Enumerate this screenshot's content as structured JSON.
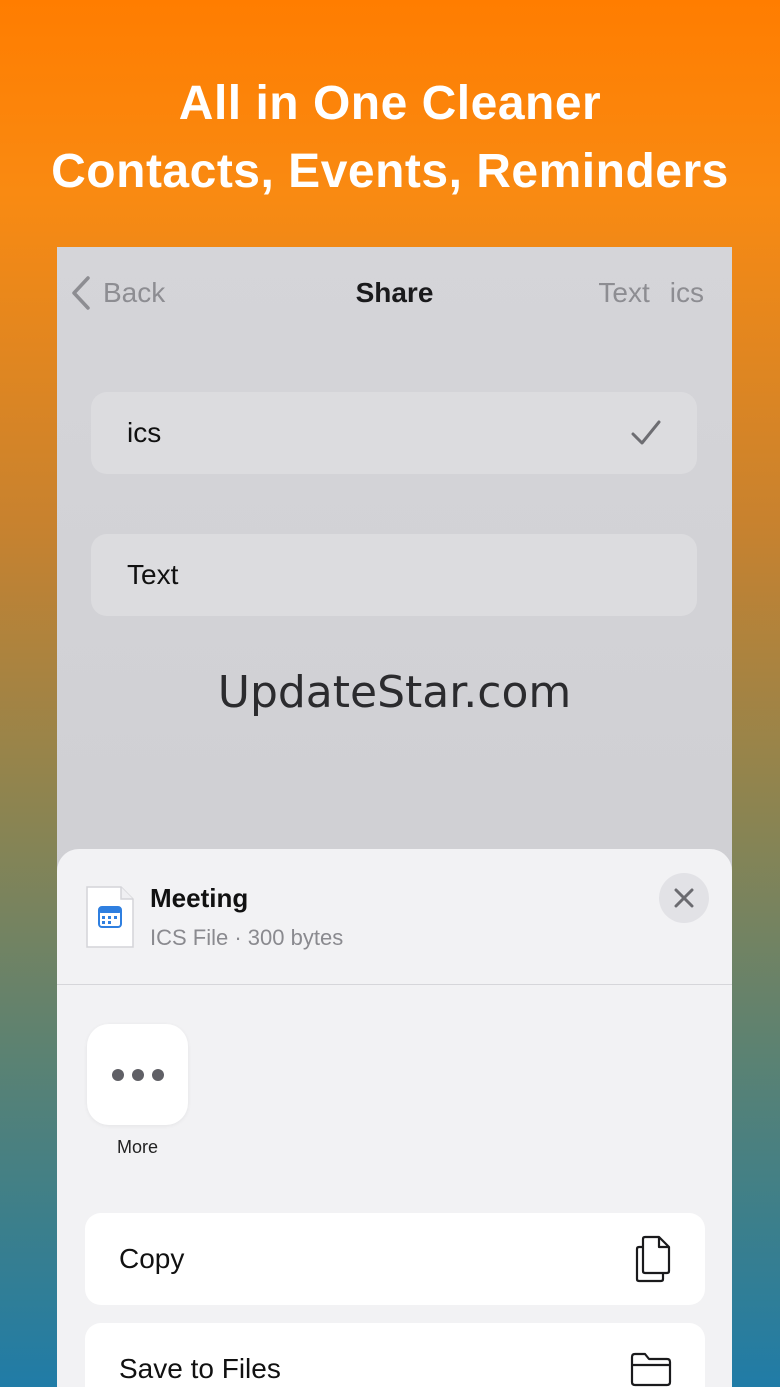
{
  "headline": {
    "line1": "All in One Cleaner",
    "line2": "Contacts, Events, Reminders"
  },
  "nav": {
    "back_label": "Back",
    "title": "Share",
    "right_items": [
      "Text",
      "ics"
    ]
  },
  "options": [
    {
      "label": "ics",
      "selected": true
    },
    {
      "label": "Text",
      "selected": false
    }
  ],
  "watermark": "UpdateStar.com",
  "share_sheet": {
    "file_name": "Meeting",
    "file_info": "ICS File · 300 bytes",
    "apps": [
      {
        "label": "More",
        "icon": "ellipsis-icon"
      }
    ],
    "actions": [
      {
        "label": "Copy",
        "icon": "copy-icon"
      },
      {
        "label": "Save to Files",
        "icon": "folder-icon"
      }
    ]
  },
  "colors": {
    "gradient_top": "#ff7d00",
    "gradient_bottom": "#207ca7",
    "calendar_blue": "#2f7fe0"
  }
}
